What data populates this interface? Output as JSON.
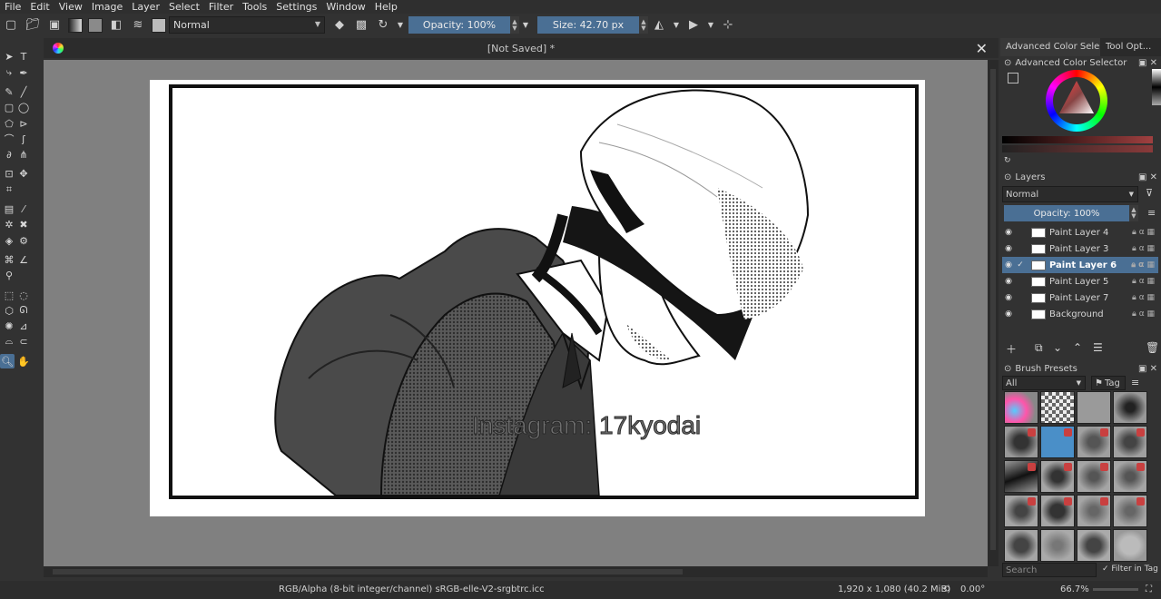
{
  "menu": [
    "File",
    "Edit",
    "View",
    "Image",
    "Layer",
    "Select",
    "Filter",
    "Tools",
    "Settings",
    "Window",
    "Help"
  ],
  "toolbar": {
    "blend_mode": "Normal",
    "opacity": "Opacity: 100%",
    "size": "Size: 42.70 px"
  },
  "document": {
    "tab_title": "[Not Saved]  *",
    "watermark": "Instagram: 17kyodai"
  },
  "dock": {
    "tabs": [
      "Advanced Color Sele...",
      "Tool Opt..."
    ],
    "color_selector_title": "Advanced Color Selector",
    "layers_title": "Layers",
    "layers_blend": "Normal",
    "layers_opacity": "Opacity:  100%",
    "layers": [
      {
        "name": "Paint Layer 4",
        "selected": false
      },
      {
        "name": "Paint Layer 3",
        "selected": false
      },
      {
        "name": "Paint Layer 6",
        "selected": true
      },
      {
        "name": "Paint Layer 5",
        "selected": false
      },
      {
        "name": "Paint Layer 7",
        "selected": false
      },
      {
        "name": "Background",
        "selected": false
      }
    ],
    "brush_presets_title": "Brush Presets",
    "brush_filter": "All",
    "brush_tag": "Tag",
    "search_placeholder": "Search",
    "filter_in_tag": "Filter in Tag"
  },
  "status": {
    "color_info": "RGB/Alpha (8-bit integer/channel)  sRGB-elle-V2-srgbtrc.icc",
    "image_size": "1,920 x 1,080 (40.2 MiB)",
    "rotation": "0.00°",
    "zoom": "66.7%"
  },
  "colors": {
    "accent": "#4a6f94",
    "panel_bg": "#323232",
    "canvas_bg": "#808080"
  }
}
